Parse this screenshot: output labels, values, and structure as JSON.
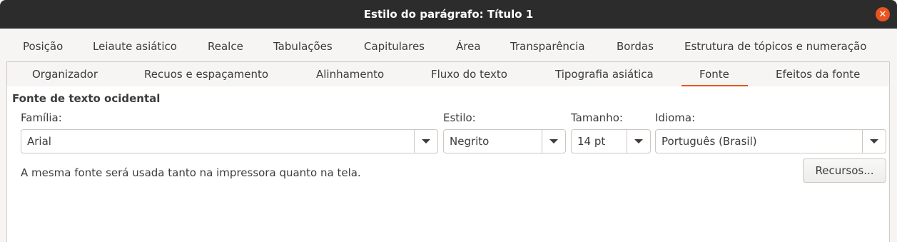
{
  "window": {
    "title": "Estilo do parágrafo: Título 1",
    "close_symbol": "✕"
  },
  "tabs_row1": [
    {
      "label": "Posição"
    },
    {
      "label": "Leiaute asiático"
    },
    {
      "label": "Realce"
    },
    {
      "label": "Tabulações"
    },
    {
      "label": "Capitulares"
    },
    {
      "label": "Área"
    },
    {
      "label": "Transparência"
    },
    {
      "label": "Bordas"
    },
    {
      "label": "Estrutura de tópicos e numeração"
    }
  ],
  "tabs_row2": [
    {
      "label": "Organizador"
    },
    {
      "label": "Recuos e espaçamento"
    },
    {
      "label": "Alinhamento"
    },
    {
      "label": "Fluxo do texto"
    },
    {
      "label": "Tipografia asiática"
    },
    {
      "label": "Fonte",
      "active": true
    },
    {
      "label": "Efeitos da fonte"
    }
  ],
  "western_font": {
    "section_title": "Fonte de texto ocidental",
    "family": {
      "label": "Família:",
      "value": "Arial"
    },
    "style": {
      "label": "Estilo:",
      "value": "Negrito"
    },
    "size": {
      "label": "Tamanho:",
      "value": "14 pt"
    },
    "language": {
      "label": "Idioma:",
      "value": "Português (Brasil)"
    },
    "note": "A mesma fonte será usada tanto na impressora quanto na tela.",
    "features_button": "Recursos..."
  },
  "colors": {
    "accent": "#e95420",
    "titlebar": "#2c2c2c"
  }
}
